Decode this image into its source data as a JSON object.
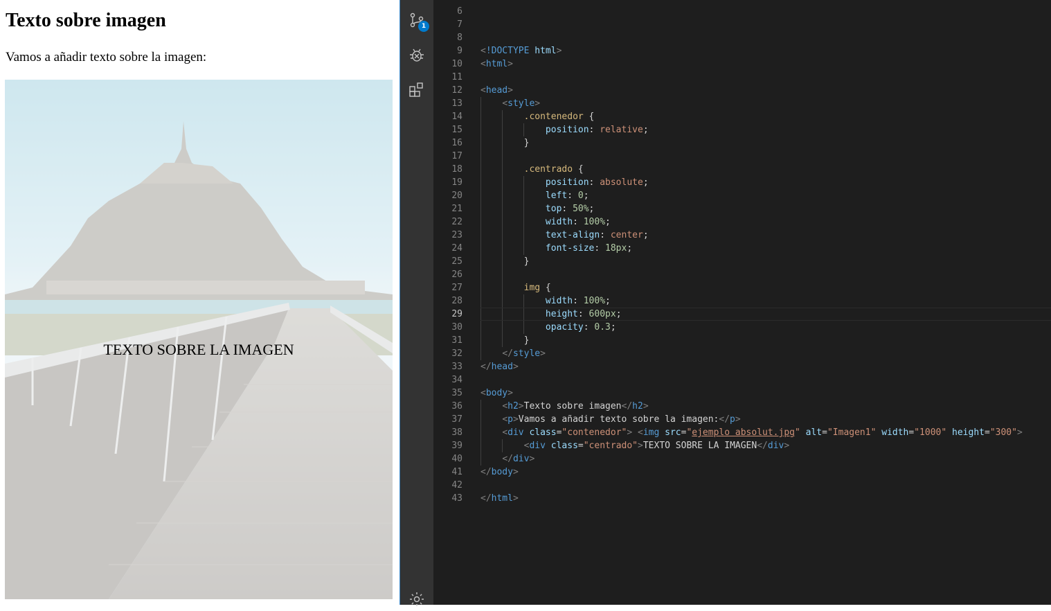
{
  "preview": {
    "heading": "Texto sobre imagen",
    "paragraph": "Vamos a añadir texto sobre la imagen:",
    "overlay_text": "TEXTO SOBRE LA IMAGEN",
    "image_opacity": 0.3
  },
  "activity_bar": {
    "items": [
      {
        "icon": "source-control-icon",
        "badge": "1"
      },
      {
        "icon": "debug-icon"
      },
      {
        "icon": "extensions-icon"
      },
      {
        "icon": "settings-gear-icon"
      }
    ]
  },
  "editor": {
    "current_line": 29,
    "line_numbers": [
      "6",
      "7",
      "8",
      "9",
      "10",
      "11",
      "12",
      "13",
      "14",
      "15",
      "16",
      "17",
      "18",
      "19",
      "20",
      "21",
      "22",
      "23",
      "24",
      "25",
      "26",
      "27",
      "28",
      "29",
      "30",
      "31",
      "32",
      "33",
      "34",
      "35",
      "36",
      "37",
      "38",
      "39",
      "40",
      "41",
      "42",
      "43"
    ],
    "lines": [
      {
        "n": "6",
        "tokens": []
      },
      {
        "n": "7",
        "tokens": []
      },
      {
        "n": "8",
        "tokens": []
      },
      {
        "n": "9",
        "tokens": [
          {
            "t": "br",
            "v": "<"
          },
          {
            "t": "tag",
            "v": "!DOCTYPE "
          },
          {
            "t": "attr",
            "v": "html"
          },
          {
            "t": "br",
            "v": ">"
          }
        ]
      },
      {
        "n": "10",
        "tokens": [
          {
            "t": "br",
            "v": "<"
          },
          {
            "t": "tag",
            "v": "html"
          },
          {
            "t": "br",
            "v": ">"
          }
        ]
      },
      {
        "n": "11",
        "tokens": []
      },
      {
        "n": "12",
        "tokens": [
          {
            "t": "br",
            "v": "<"
          },
          {
            "t": "tag",
            "v": "head"
          },
          {
            "t": "br",
            "v": ">"
          }
        ]
      },
      {
        "n": "13",
        "tokens": [
          {
            "t": "txt",
            "v": "    "
          },
          {
            "t": "br",
            "v": "<"
          },
          {
            "t": "tag",
            "v": "style"
          },
          {
            "t": "br",
            "v": ">"
          }
        ]
      },
      {
        "n": "14",
        "tokens": [
          {
            "t": "txt",
            "v": "        "
          },
          {
            "t": "sel",
            "v": ".contenedor"
          },
          {
            "t": "txt",
            "v": " {"
          }
        ]
      },
      {
        "n": "15",
        "tokens": [
          {
            "t": "txt",
            "v": "            "
          },
          {
            "t": "prop",
            "v": "position"
          },
          {
            "t": "txt",
            "v": ": "
          },
          {
            "t": "val",
            "v": "relative"
          },
          {
            "t": "txt",
            "v": ";"
          }
        ]
      },
      {
        "n": "16",
        "tokens": [
          {
            "t": "txt",
            "v": "        }"
          }
        ]
      },
      {
        "n": "17",
        "tokens": []
      },
      {
        "n": "18",
        "tokens": [
          {
            "t": "txt",
            "v": "        "
          },
          {
            "t": "sel",
            "v": ".centrado"
          },
          {
            "t": "txt",
            "v": " {"
          }
        ]
      },
      {
        "n": "19",
        "tokens": [
          {
            "t": "txt",
            "v": "            "
          },
          {
            "t": "prop",
            "v": "position"
          },
          {
            "t": "txt",
            "v": ": "
          },
          {
            "t": "val",
            "v": "absolute"
          },
          {
            "t": "txt",
            "v": ";"
          }
        ]
      },
      {
        "n": "20",
        "tokens": [
          {
            "t": "txt",
            "v": "            "
          },
          {
            "t": "prop",
            "v": "left"
          },
          {
            "t": "txt",
            "v": ": "
          },
          {
            "t": "num",
            "v": "0"
          },
          {
            "t": "txt",
            "v": ";"
          }
        ]
      },
      {
        "n": "21",
        "tokens": [
          {
            "t": "txt",
            "v": "            "
          },
          {
            "t": "prop",
            "v": "top"
          },
          {
            "t": "txt",
            "v": ": "
          },
          {
            "t": "num",
            "v": "50%"
          },
          {
            "t": "txt",
            "v": ";"
          }
        ]
      },
      {
        "n": "22",
        "tokens": [
          {
            "t": "txt",
            "v": "            "
          },
          {
            "t": "prop",
            "v": "width"
          },
          {
            "t": "txt",
            "v": ": "
          },
          {
            "t": "num",
            "v": "100%"
          },
          {
            "t": "txt",
            "v": ";"
          }
        ]
      },
      {
        "n": "23",
        "tokens": [
          {
            "t": "txt",
            "v": "            "
          },
          {
            "t": "prop",
            "v": "text-align"
          },
          {
            "t": "txt",
            "v": ": "
          },
          {
            "t": "val",
            "v": "center"
          },
          {
            "t": "txt",
            "v": ";"
          }
        ]
      },
      {
        "n": "24",
        "tokens": [
          {
            "t": "txt",
            "v": "            "
          },
          {
            "t": "prop",
            "v": "font-size"
          },
          {
            "t": "txt",
            "v": ": "
          },
          {
            "t": "num",
            "v": "18px"
          },
          {
            "t": "txt",
            "v": ";"
          }
        ]
      },
      {
        "n": "25",
        "tokens": [
          {
            "t": "txt",
            "v": "        }"
          }
        ]
      },
      {
        "n": "26",
        "tokens": []
      },
      {
        "n": "27",
        "tokens": [
          {
            "t": "txt",
            "v": "        "
          },
          {
            "t": "sel",
            "v": "img"
          },
          {
            "t": "txt",
            "v": " {"
          }
        ]
      },
      {
        "n": "28",
        "tokens": [
          {
            "t": "txt",
            "v": "            "
          },
          {
            "t": "prop",
            "v": "width"
          },
          {
            "t": "txt",
            "v": ": "
          },
          {
            "t": "num",
            "v": "100%"
          },
          {
            "t": "txt",
            "v": ";"
          }
        ]
      },
      {
        "n": "29",
        "tokens": [
          {
            "t": "txt",
            "v": "            "
          },
          {
            "t": "prop",
            "v": "height"
          },
          {
            "t": "txt",
            "v": ": "
          },
          {
            "t": "num",
            "v": "600px"
          },
          {
            "t": "txt",
            "v": ";"
          }
        ]
      },
      {
        "n": "30",
        "tokens": [
          {
            "t": "txt",
            "v": "            "
          },
          {
            "t": "prop",
            "v": "opacity"
          },
          {
            "t": "txt",
            "v": ": "
          },
          {
            "t": "num",
            "v": "0.3"
          },
          {
            "t": "txt",
            "v": ";"
          }
        ]
      },
      {
        "n": "31",
        "tokens": [
          {
            "t": "txt",
            "v": "        }"
          }
        ]
      },
      {
        "n": "32",
        "tokens": [
          {
            "t": "txt",
            "v": "    "
          },
          {
            "t": "br",
            "v": "</"
          },
          {
            "t": "tag",
            "v": "style"
          },
          {
            "t": "br",
            "v": ">"
          }
        ]
      },
      {
        "n": "33",
        "tokens": [
          {
            "t": "br",
            "v": "</"
          },
          {
            "t": "tag",
            "v": "head"
          },
          {
            "t": "br",
            "v": ">"
          }
        ]
      },
      {
        "n": "34",
        "tokens": []
      },
      {
        "n": "35",
        "tokens": [
          {
            "t": "br",
            "v": "<"
          },
          {
            "t": "tag",
            "v": "body"
          },
          {
            "t": "br",
            "v": ">"
          }
        ]
      },
      {
        "n": "36",
        "tokens": [
          {
            "t": "txt",
            "v": "    "
          },
          {
            "t": "br",
            "v": "<"
          },
          {
            "t": "tag",
            "v": "h2"
          },
          {
            "t": "br",
            "v": ">"
          },
          {
            "t": "txt",
            "v": "Texto sobre imagen"
          },
          {
            "t": "br",
            "v": "</"
          },
          {
            "t": "tag",
            "v": "h2"
          },
          {
            "t": "br",
            "v": ">"
          }
        ]
      },
      {
        "n": "37",
        "tokens": [
          {
            "t": "txt",
            "v": "    "
          },
          {
            "t": "br",
            "v": "<"
          },
          {
            "t": "tag",
            "v": "p"
          },
          {
            "t": "br",
            "v": ">"
          },
          {
            "t": "txt",
            "v": "Vamos a añadir texto sobre la imagen:"
          },
          {
            "t": "br",
            "v": "</"
          },
          {
            "t": "tag",
            "v": "p"
          },
          {
            "t": "br",
            "v": ">"
          }
        ]
      },
      {
        "n": "38",
        "tokens": [
          {
            "t": "txt",
            "v": "    "
          },
          {
            "t": "br",
            "v": "<"
          },
          {
            "t": "tag",
            "v": "div"
          },
          {
            "t": "txt",
            "v": " "
          },
          {
            "t": "attr",
            "v": "class"
          },
          {
            "t": "txt",
            "v": "="
          },
          {
            "t": "str",
            "v": "\"contenedor\""
          },
          {
            "t": "br",
            "v": ">"
          },
          {
            "t": "txt",
            "v": " "
          },
          {
            "t": "br",
            "v": "<"
          },
          {
            "t": "tag",
            "v": "img"
          },
          {
            "t": "txt",
            "v": " "
          },
          {
            "t": "attr",
            "v": "src"
          },
          {
            "t": "txt",
            "v": "="
          },
          {
            "t": "str",
            "v": "\""
          },
          {
            "t": "link",
            "v": "ejemplo absolut.jpg"
          },
          {
            "t": "str",
            "v": "\""
          },
          {
            "t": "txt",
            "v": " "
          },
          {
            "t": "attr",
            "v": "alt"
          },
          {
            "t": "txt",
            "v": "="
          },
          {
            "t": "str",
            "v": "\"Imagen1\""
          },
          {
            "t": "txt",
            "v": " "
          },
          {
            "t": "attr",
            "v": "width"
          },
          {
            "t": "txt",
            "v": "="
          },
          {
            "t": "str",
            "v": "\"1000\""
          },
          {
            "t": "txt",
            "v": " "
          },
          {
            "t": "attr",
            "v": "height"
          },
          {
            "t": "txt",
            "v": "="
          },
          {
            "t": "str",
            "v": "\"300\""
          },
          {
            "t": "br",
            "v": ">"
          }
        ]
      },
      {
        "n": "39",
        "tokens": [
          {
            "t": "txt",
            "v": "        "
          },
          {
            "t": "br",
            "v": "<"
          },
          {
            "t": "tag",
            "v": "div"
          },
          {
            "t": "txt",
            "v": " "
          },
          {
            "t": "attr",
            "v": "class"
          },
          {
            "t": "txt",
            "v": "="
          },
          {
            "t": "str",
            "v": "\"centrado\""
          },
          {
            "t": "br",
            "v": ">"
          },
          {
            "t": "txt",
            "v": "TEXTO SOBRE LA IMAGEN"
          },
          {
            "t": "br",
            "v": "</"
          },
          {
            "t": "tag",
            "v": "div"
          },
          {
            "t": "br",
            "v": ">"
          }
        ]
      },
      {
        "n": "40",
        "tokens": [
          {
            "t": "txt",
            "v": "    "
          },
          {
            "t": "br",
            "v": "</"
          },
          {
            "t": "tag",
            "v": "div"
          },
          {
            "t": "br",
            "v": ">"
          }
        ]
      },
      {
        "n": "41",
        "tokens": [
          {
            "t": "br",
            "v": "</"
          },
          {
            "t": "tag",
            "v": "body"
          },
          {
            "t": "br",
            "v": ">"
          }
        ]
      },
      {
        "n": "42",
        "tokens": []
      },
      {
        "n": "43",
        "tokens": [
          {
            "t": "br",
            "v": "</"
          },
          {
            "t": "tag",
            "v": "html"
          },
          {
            "t": "br",
            "v": ">"
          }
        ]
      }
    ]
  },
  "colors": {
    "editor_bg": "#1e1e1e",
    "activity_bg": "#333333",
    "accent": "#007acc",
    "tag": "#569cd6",
    "selector": "#d7ba7d",
    "property": "#9cdcfe",
    "string": "#ce9178",
    "number": "#b5cea8"
  }
}
